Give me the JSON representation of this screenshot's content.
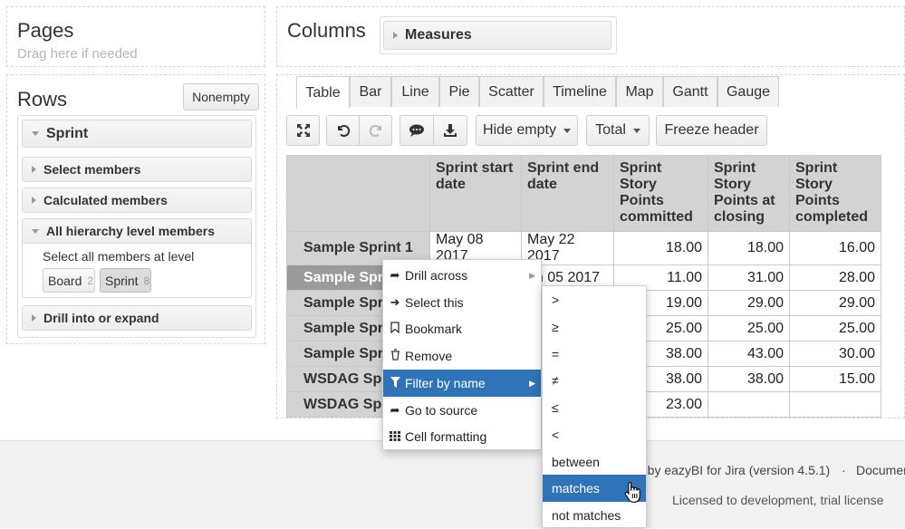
{
  "pages": {
    "title": "Pages",
    "hint": "Drag here if needed"
  },
  "rows": {
    "title": "Rows",
    "nonempty_label": "Nonempty",
    "dimension": "Sprint",
    "sections": [
      {
        "label": "Select members",
        "expanded": false
      },
      {
        "label": "Calculated members",
        "expanded": false
      },
      {
        "label": "All hierarchy level members",
        "expanded": true
      },
      {
        "label": "Drill into or expand",
        "expanded": false
      }
    ],
    "level_hint": "Select all members at level",
    "levels": [
      {
        "name": "Board",
        "count": "2"
      },
      {
        "name": "Sprint",
        "count": "8"
      }
    ]
  },
  "columns": {
    "title": "Columns",
    "dimension": "Measures"
  },
  "tabs": [
    "Table",
    "Bar",
    "Line",
    "Pie",
    "Scatter",
    "Timeline",
    "Map",
    "Gantt",
    "Gauge"
  ],
  "active_tab": "Table",
  "toolbar": {
    "hide_empty": "Hide empty",
    "total": "Total",
    "freeze_header": "Freeze header",
    "icons": [
      "expand-icon",
      "undo-icon",
      "redo-icon",
      "comment-icon",
      "download-icon"
    ]
  },
  "table": {
    "headers": [
      "Sprint start date",
      "Sprint end date",
      "Sprint Story Points committed",
      "Sprint Story Points at closing",
      "Sprint Story Points completed"
    ],
    "rows": [
      {
        "name": "Sample Sprint 1",
        "start": "May 08 2017",
        "end": "May 22 2017",
        "committed": "18.00",
        "closing": "18.00",
        "completed": "16.00"
      },
      {
        "name": "Sample Spr",
        "start": "",
        "end": "un 05 2017",
        "committed": "11.00",
        "closing": "31.00",
        "completed": "28.00"
      },
      {
        "name": "Sample Spr",
        "start": "",
        "end": "",
        "committed": "19.00",
        "closing": "29.00",
        "completed": "29.00"
      },
      {
        "name": "Sample Spr",
        "start": "",
        "end": "",
        "committed": "25.00",
        "closing": "25.00",
        "completed": "25.00"
      },
      {
        "name": "Sample Spr",
        "start": "",
        "end": "",
        "committed": "38.00",
        "closing": "43.00",
        "completed": "30.00"
      },
      {
        "name": "WSDAG Spr",
        "start": "",
        "end": "",
        "committed": "38.00",
        "closing": "38.00",
        "completed": "15.00"
      },
      {
        "name": "WSDAG Spr",
        "start": "",
        "end": "",
        "committed": "23.00",
        "closing": "",
        "completed": ""
      }
    ]
  },
  "context_menu": {
    "items": [
      {
        "label": "Drill across",
        "icon": "share-arrow-icon",
        "has_submenu": true
      },
      {
        "label": "Select this",
        "icon": "arrow-right-icon",
        "has_submenu": false
      },
      {
        "label": "Bookmark",
        "icon": "bookmark-icon",
        "has_submenu": false
      },
      {
        "label": "Remove",
        "icon": "trash-icon",
        "has_submenu": false
      },
      {
        "label": "Filter by name",
        "icon": "filter-icon",
        "has_submenu": true
      },
      {
        "label": "Go to source",
        "icon": "share-arrow-icon",
        "has_submenu": false
      },
      {
        "label": "Cell formatting",
        "icon": "grid-icon",
        "has_submenu": false
      }
    ],
    "highlighted": "Filter by name"
  },
  "filter_submenu": {
    "items": [
      ">",
      "≥",
      "=",
      "≠",
      "≤",
      "<",
      "between",
      "matches",
      "not matches"
    ],
    "highlighted": "matches"
  },
  "footer": {
    "powered": "d by eazyBI for Jira (version 4.5.1)",
    "sep": "·",
    "docs": "Documen",
    "license": "Licensed to development, trial license"
  },
  "colors": {
    "highlight": "#2f73b8",
    "header_bg": "#d3d3d3"
  }
}
